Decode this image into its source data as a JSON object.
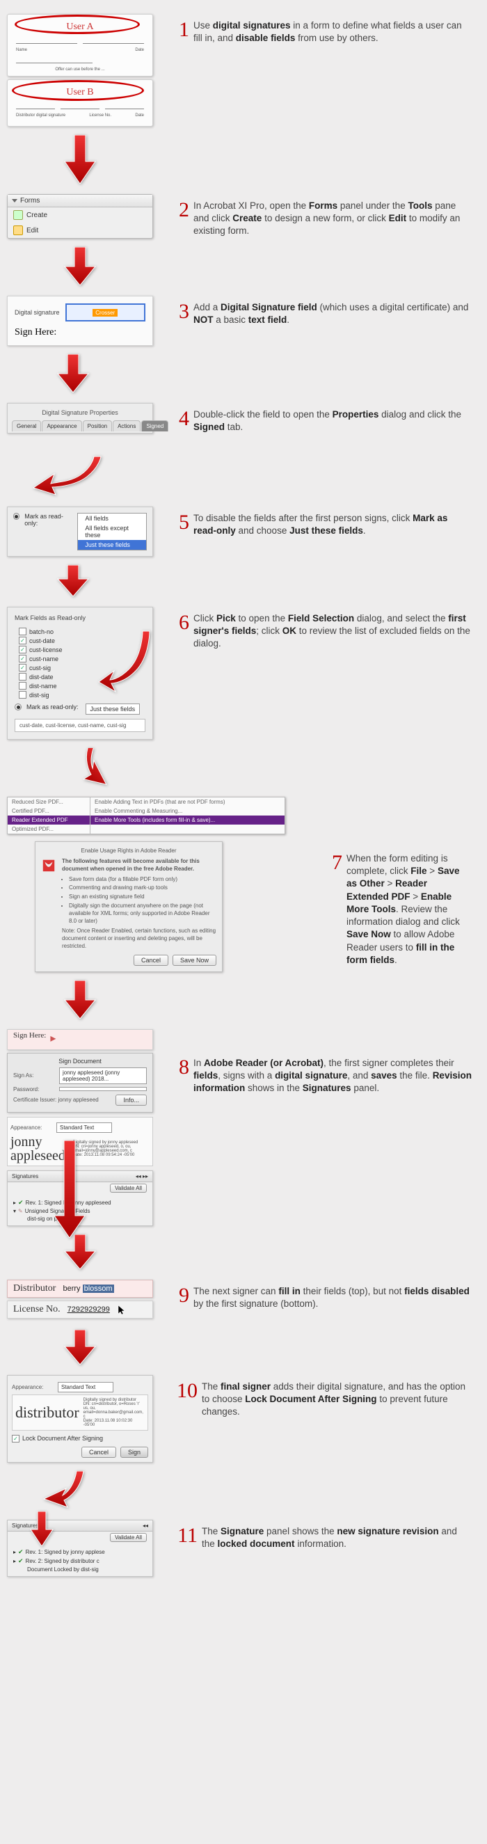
{
  "steps": [
    {
      "n": "1",
      "text_pre": "Use ",
      "b1": "digital signatures",
      "text_mid": " in a form to define what fields a user can fill in, and ",
      "b2": "disable fields",
      "text_post": " from use by others."
    },
    {
      "n": "2",
      "text": "In Acrobat XI Pro, open the ",
      "b1": "Forms",
      "m1": " panel under the ",
      "b2": "Tools",
      "m2": " pane and click ",
      "b3": "Create",
      "m3": " to design a new form, or click ",
      "b4": "Edit",
      "m4": " to modify an existing form."
    },
    {
      "n": "3",
      "t1": "Add a ",
      "b1": "Digital Signature field",
      "t2": " (which uses a digital certificate) and ",
      "b2": "NOT",
      "t3": " a basic ",
      "b3": "text field",
      "t4": "."
    },
    {
      "n": "4",
      "t1": "Double-click the field to open the ",
      "b1": "Properties",
      "t2": " dialog and click the ",
      "b2": "Signed",
      "t3": " tab."
    },
    {
      "n": "5",
      "t1": "To disable the fields after the first person signs, click ",
      "b1": "Mark as read-only",
      "t2": " and choose ",
      "b2": "Just these fields",
      "t3": "."
    },
    {
      "n": "6",
      "t1": "Click ",
      "b1": "Pick",
      "t2": " to open the ",
      "b2": "Field Selection",
      "t3": " dialog, and select the ",
      "b3": "first signer's fields",
      "t4": "; click ",
      "b4": "OK",
      "t5": " to review the list of excluded fields on the dialog."
    },
    {
      "n": "7",
      "t1": "When the form editing is complete, click ",
      "b1": "File",
      "t2": " > ",
      "b2": "Save as Other",
      "t3": " > ",
      "b3": "Reader Extended PDF",
      "t4": " > ",
      "b4": "Enable More Tools",
      "t5": ". Review the information dialog and click ",
      "b5": "Save Now",
      "t6": " to allow Adobe Reader users to ",
      "b6": "fill in the form fields",
      "t7": "."
    },
    {
      "n": "8",
      "t1": "In ",
      "b1": "Adobe Reader (or Acrobat)",
      "t2": ", the first signer completes their ",
      "b2": "fields",
      "t3": ", signs with a ",
      "b3": "digital signature",
      "t4": ", and ",
      "b4": "saves",
      "t5": " the file. ",
      "b5": "Revision information",
      "t6": " shows in the ",
      "b6": "Signatures",
      "t7": " panel."
    },
    {
      "n": "9",
      "t1": "The next signer can ",
      "b1": "fill in",
      "t2": " their fields (top), but not ",
      "b2": "fields disabled",
      "t3": " by the first signature (bottom)."
    },
    {
      "n": "10",
      "t1": "The ",
      "b1": "final signer",
      "t2": " adds their digital signature, and has the option to choose ",
      "b2": "Lock Document After Signing",
      "t3": " to prevent future changes."
    },
    {
      "n": "11",
      "t1": "The ",
      "b1": "Signature",
      "t2": " panel shows the ",
      "b2": "new signature revision",
      "t3": " and the ",
      "b3": "locked document",
      "t4": " information."
    }
  ],
  "s1": {
    "userA": "User A",
    "userB": "User B",
    "offer": "Offer can use before the ..."
  },
  "s2": {
    "panel_title": "Forms",
    "create": "Create",
    "edit": "Edit"
  },
  "s3": {
    "label": "Digital signature",
    "placeholder": "Crosser",
    "sign_here": "Sign Here:"
  },
  "s4": {
    "title": "Digital Signature Properties",
    "tabs": [
      "General",
      "Appearance",
      "Position",
      "Actions",
      "Signed"
    ]
  },
  "s5": {
    "label": "Mark as read-only:",
    "opts": [
      "All fields",
      "All fields except these",
      "Just these fields"
    ]
  },
  "s6": {
    "title": "Mark Fields as Read-only",
    "items": [
      {
        "l": "batch-no",
        "c": false
      },
      {
        "l": "cust-date",
        "c": true
      },
      {
        "l": "cust-license",
        "c": true
      },
      {
        "l": "cust-name",
        "c": true
      },
      {
        "l": "cust-sig",
        "c": true
      },
      {
        "l": "dist-date",
        "c": false
      },
      {
        "l": "dist-name",
        "c": false
      },
      {
        "l": "dist-sig",
        "c": false
      }
    ],
    "readonly_label": "Mark as read-only:",
    "dd": "Just these fields",
    "out": "cust-date, cust-license, cust-name, cust-sig"
  },
  "s7": {
    "left": [
      "Reduced Size PDF...",
      "Certified PDF...",
      "Reader Extended PDF",
      "Optimized PDF..."
    ],
    "right": [
      "Enable Adding Text in PDFs (that are not PDF forms)",
      "Enable Commenting & Measuring...",
      "Enable More Tools (includes form fill-in & save)..."
    ],
    "dlg_title": "Enable Usage Rights in Adobe Reader",
    "lead": "The following features will become available for this document when opened in the free Adobe Reader.",
    "bullets": [
      "Save form data (for a fillable PDF form only)",
      "Commenting and drawing mark-up tools",
      "Sign an existing signature field",
      "Digitally sign the document anywhere on the page (not available for XML forms; only supported in Adobe Reader 8.0 or later)"
    ],
    "note": "Note: Once Reader Enabled, certain functions, such as editing document content or inserting and deleting pages, will be restricted.",
    "cancel": "Cancel",
    "save": "Save Now"
  },
  "s8": {
    "sign_here": "Sign Here:",
    "dlg_title": "Sign Document",
    "sign_as_label": "Sign As:",
    "sign_as_value": "jonny appleseed (jonny appleseed) 2018...",
    "password_label": "Password:",
    "cert_label": "Certificate Issuer: jonny appleseed",
    "info_btn": "Info...",
    "appearance_label": "Appearance:",
    "appearance_value": "Standard Text",
    "sig_name": "jonny appleseed",
    "sig_meta": "Digitally signed by jonny appleseed\nDN: cn=jonny appleseed, o, ou, email=jonny@appleseed.com, c\nDate: 2013.11.08 09:54:24 -05'00",
    "sigs_title": "Signatures",
    "validate": "Validate All",
    "tree": [
      "Rev. 1: Signed by jonny appleseed",
      "Unsigned Signature Fields",
      "dist-sig on page 1"
    ]
  },
  "s9": {
    "distributor": "Distributor",
    "dist_val_pre": "berry ",
    "dist_val_sel": "blossom",
    "license": "License No.",
    "license_val": "7292929299"
  },
  "s10": {
    "appearance_label": "Appearance:",
    "appearance_value": "Standard Text",
    "sig_name": "distributor",
    "sig_meta": "Digitally signed by distributor\nDN: cn=distributor, o=Roses 'r' us, ou, email=donna.baker@gmail.com, c\nDate: 2013.11.08 10:02:30 -05'00",
    "lock": "Lock Document After Signing",
    "cancel": "Cancel",
    "sign": "Sign"
  },
  "s11": {
    "title": "Signatures",
    "validate": "Validate All",
    "tree": [
      "Rev. 1: Signed by jonny applese",
      "Rev. 2: Signed by distributor c",
      "Document Locked by dist-sig"
    ]
  }
}
